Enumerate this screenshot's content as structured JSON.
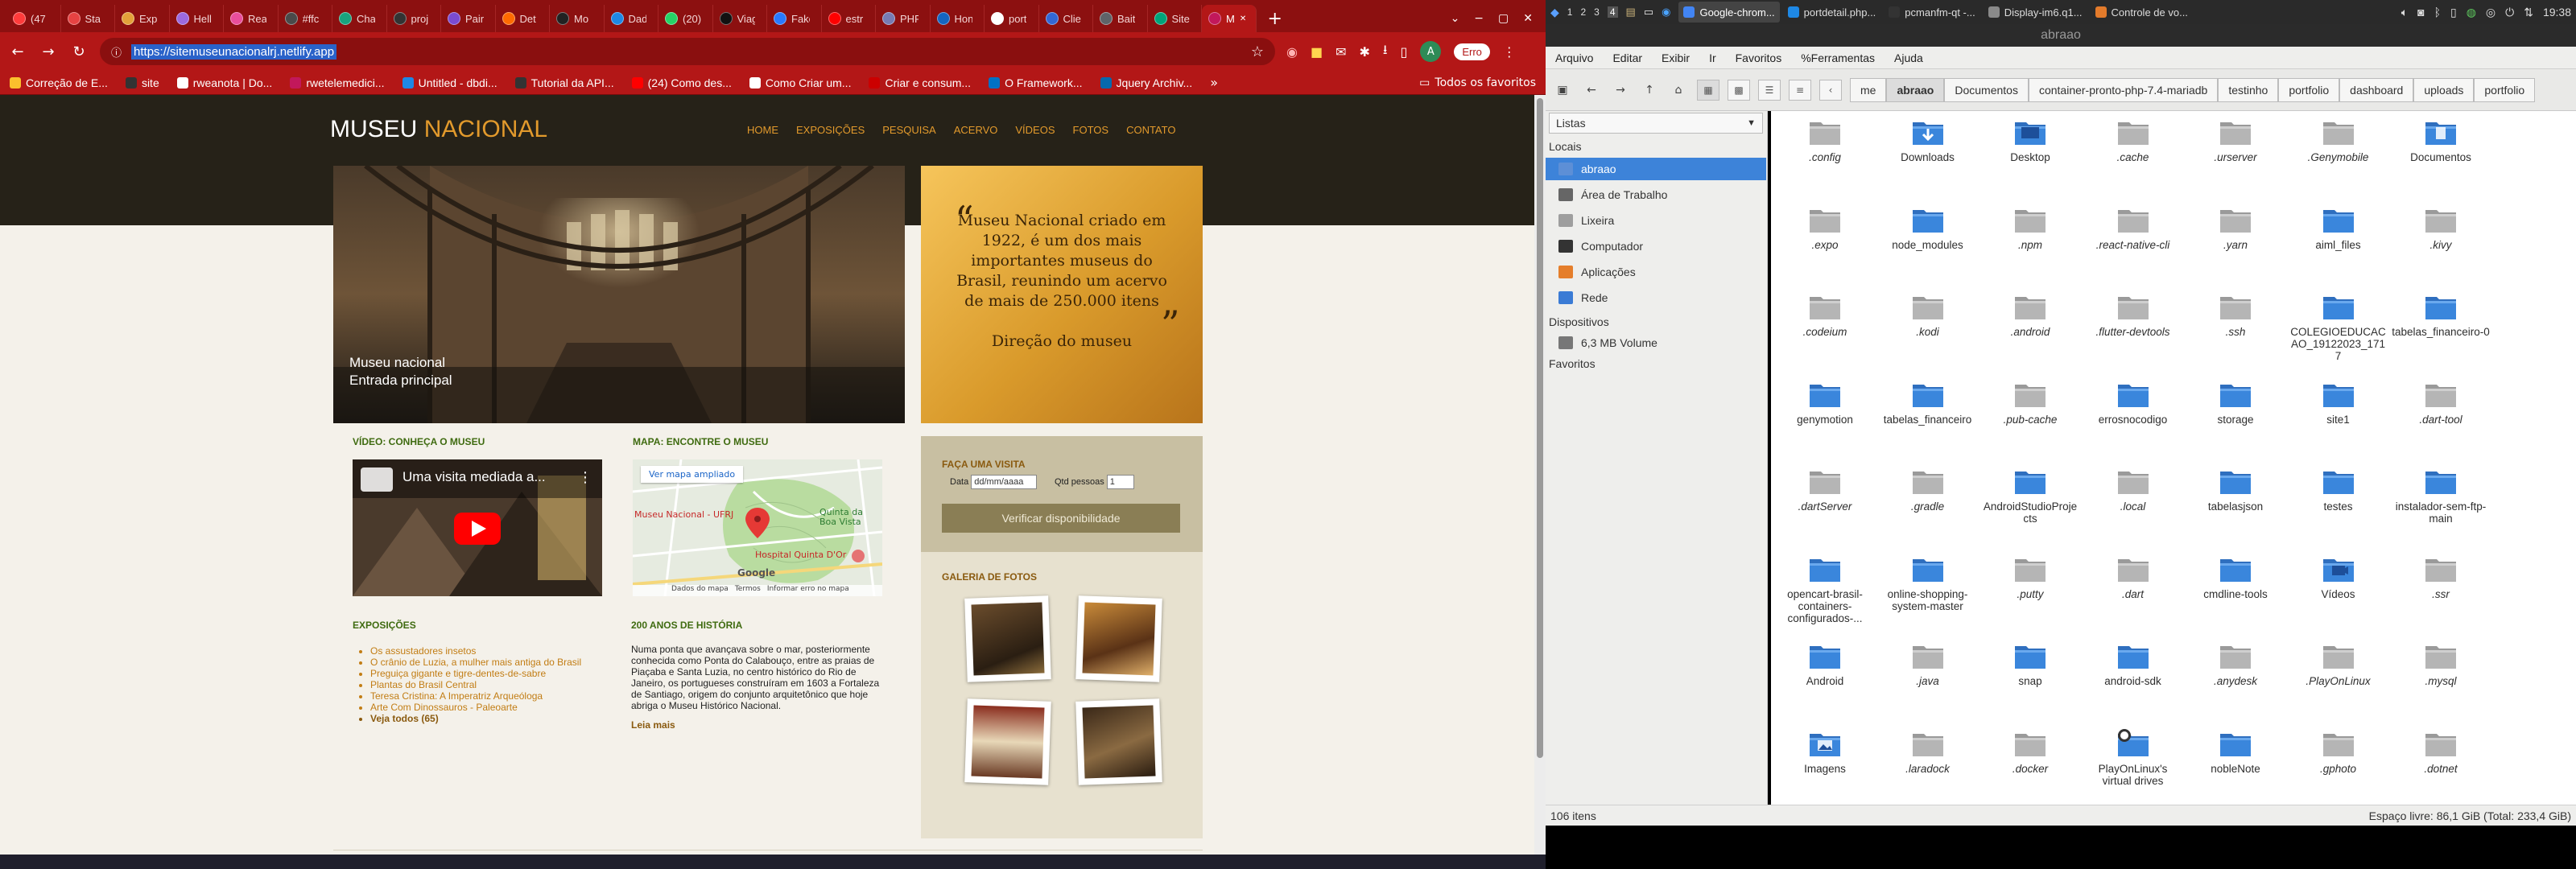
{
  "browser": {
    "tabs": [
      {
        "label": "(47",
        "color": "#ff3b3b"
      },
      {
        "label": "Sta",
        "color": "#e64242"
      },
      {
        "label": "Exp",
        "color": "#e3a13a"
      },
      {
        "label": "Hell",
        "color": "#9c6ade"
      },
      {
        "label": "Rea",
        "color": "#e94e9b"
      },
      {
        "label": "#ffc",
        "color": "#4a4a4a"
      },
      {
        "label": "Cha",
        "color": "#19a37e"
      },
      {
        "label": "proj",
        "color": "#333333"
      },
      {
        "label": "Pair",
        "color": "#7a4bd1"
      },
      {
        "label": "Det",
        "color": "#ff6a00"
      },
      {
        "label": "Mo",
        "color": "#222222"
      },
      {
        "label": "Dad",
        "color": "#1e88e5"
      },
      {
        "label": "(20)",
        "color": "#25d366"
      },
      {
        "label": "Viag",
        "color": "#111111"
      },
      {
        "label": "Fake",
        "color": "#2979ff"
      },
      {
        "label": "estr",
        "color": "#ff0000"
      },
      {
        "label": "PHP",
        "color": "#777bb3"
      },
      {
        "label": "Hon",
        "color": "#1565c0"
      },
      {
        "label": "port",
        "color": "#ffffff"
      },
      {
        "label": "Clie",
        "color": "#3367d6"
      },
      {
        "label": "Bait",
        "color": "#5f6368"
      },
      {
        "label": "Site",
        "color": "#00a37a"
      },
      {
        "label": "M",
        "color": "#c2185b"
      }
    ],
    "active_tab_index": 22,
    "url": "https://sitemuseunacionalrj.netlify.app",
    "error_pill": "Erro",
    "profile_initial": "A",
    "bookmarks": [
      {
        "label": "Correção de E...",
        "color": "#fbc02d"
      },
      {
        "label": "site",
        "color": "#333333"
      },
      {
        "label": "rweanota | Do...",
        "color": "#ffffff"
      },
      {
        "label": "rwetelemedici...",
        "color": "#c2185b"
      },
      {
        "label": "Untitled - dbdi...",
        "color": "#1e88e5"
      },
      {
        "label": "Tutorial da API...",
        "color": "#333333"
      },
      {
        "label": "(24) Como des...",
        "color": "#ff0000"
      },
      {
        "label": "Como Criar um...",
        "color": "#ffffff"
      },
      {
        "label": "Criar e consum...",
        "color": "#cc0000"
      },
      {
        "label": "O Framework...",
        "color": "#0071c5"
      },
      {
        "label": "Jquery Archiv...",
        "color": "#0769ad"
      }
    ],
    "all_bookmarks_label": "Todos os favoritos"
  },
  "site": {
    "logo_main": "MUSEU",
    "logo_accent": "NACIONAL",
    "nav": [
      "HOME",
      "EXPOSIÇÕES",
      "PESQUISA",
      "ACERVO",
      "VÍDEOS",
      "FOTOS",
      "CONTATO"
    ],
    "hero_caption_1": "Museu nacional",
    "hero_caption_2": "Entrada principal",
    "quote": "Museu Nacional criado em 1922, é um dos mais importantes museus do Brasil, reunindo um acervo de mais de 250.000 itens",
    "quote_author": "Direção do museu",
    "video_section_title": "VÍDEO: CONHEÇA O MUSEU",
    "video_title": "Uma visita mediada a...",
    "map_section_title": "MAPA: ENCONTRE O MUSEU",
    "map_link": "Ver mapa ampliado",
    "map_labels": {
      "museum": "Museu Nacional - UFRJ",
      "quinta": "Quinta da Boa Vista",
      "hospital": "Hospital Quinta D'Or",
      "brand": "Google",
      "footer": [
        "Dados do mapa",
        "Termos",
        "Informar erro no mapa"
      ]
    },
    "visit_title": "FAÇA UMA VISITA",
    "visit_date_label": "Data",
    "visit_date_placeholder": "dd/mm/aaaa",
    "visit_qty_label": "Qtd pessoas",
    "visit_qty_value": "1",
    "visit_button": "Verificar disponibilidade",
    "gallery_title": "GALERIA DE FOTOS",
    "expos_title": "EXPOSIÇÕES",
    "expos": [
      "Os assustadores insetos",
      "O crânio de Luzia, a mulher mais antiga do Brasil",
      "Preguiça gigante e tigre-dentes-de-sabre",
      "Plantas do Brasil Central",
      "Teresa Cristina: A Imperatriz Arqueóloga",
      "Arte Com Dinossauros - Paleoarte"
    ],
    "expos_more": "Veja todos (65)",
    "history_title": "200 ANOS DE HISTÓRIA",
    "history_text": "Numa ponta que avançava sobre o mar, posteriormente conhecida como Ponta do Calabouço, entre as praias de Piaçaba e Santa Luzia, no centro histórico do Rio de Janeiro, os portugueses construíram em 1603 a Fortaleza de Santiago, origem do conjunto arquitetônico que hoje abriga o Museu Histórico Nacional.",
    "history_more": "Leia mais"
  },
  "desktop": {
    "workspaces": [
      "1",
      "2",
      "3",
      "4"
    ],
    "tasks": [
      {
        "label": "Google-chrom...",
        "color": "#4285f4"
      },
      {
        "label": "portdetail.php...",
        "color": "#1e88e5"
      },
      {
        "label": "pcmanfm-qt -...",
        "color": "#333333"
      },
      {
        "label": "Display-im6.q1...",
        "color": "#8a8a8a"
      },
      {
        "label": "Controle de vo...",
        "color": "#e37b2b"
      }
    ],
    "clock": "19:38"
  },
  "files": {
    "window_title": "abraao",
    "menu": [
      "Arquivo",
      "Editar",
      "Exibir",
      "Ir",
      "Favoritos",
      "%Ferramentas",
      "Ajuda"
    ],
    "breadcrumbs": [
      "me",
      "abraao",
      "Documentos",
      "container-pronto-php-7.4-mariadb",
      "testinho",
      "portfolio",
      "dashboard",
      "uploads",
      "portfolio"
    ],
    "current_crumb_index": 1,
    "sidebar_mode": "Listas",
    "places_title": "Locais",
    "places": [
      {
        "label": "abraao",
        "color": "#5d8fd6"
      },
      {
        "label": "Área de Trabalho",
        "color": "#666666"
      },
      {
        "label": "Lixeira",
        "color": "#9e9e9e"
      },
      {
        "label": "Computador",
        "color": "#333333"
      },
      {
        "label": "Aplicações",
        "color": "#e57e2b"
      },
      {
        "label": "Rede",
        "color": "#3a7bd5"
      }
    ],
    "devices_title": "Dispositivos",
    "devices": [
      {
        "label": "6,3 MB Volume",
        "color": "#777777"
      }
    ],
    "bookmarks_title": "Favoritos",
    "items": [
      {
        "name": ".config",
        "type": "hidden"
      },
      {
        "name": "Downloads",
        "type": "downloads"
      },
      {
        "name": "Desktop",
        "type": "desktop"
      },
      {
        "name": ".cache",
        "type": "hidden"
      },
      {
        "name": ".urserver",
        "type": "hidden"
      },
      {
        "name": ".Genymobile",
        "type": "hidden"
      },
      {
        "name": "Documentos",
        "type": "docs"
      },
      {
        "name": ".expo",
        "type": "hidden"
      },
      {
        "name": "node_modules",
        "type": "folder"
      },
      {
        "name": ".npm",
        "type": "hidden"
      },
      {
        "name": ".react-native-cli",
        "type": "hidden"
      },
      {
        "name": ".yarn",
        "type": "hidden"
      },
      {
        "name": "aiml_files",
        "type": "folder"
      },
      {
        "name": ".kivy",
        "type": "hidden"
      },
      {
        "name": ".codeium",
        "type": "hidden"
      },
      {
        "name": ".kodi",
        "type": "hidden"
      },
      {
        "name": ".android",
        "type": "hidden"
      },
      {
        "name": ".flutter-devtools",
        "type": "hidden"
      },
      {
        "name": ".ssh",
        "type": "hidden"
      },
      {
        "name": "COLEGIOEDUCACAO_19122023_1717",
        "type": "folder"
      },
      {
        "name": "tabelas_financeiro-0",
        "type": "folder"
      },
      {
        "name": "genymotion",
        "type": "folder"
      },
      {
        "name": "tabelas_financeiro",
        "type": "folder"
      },
      {
        "name": ".pub-cache",
        "type": "hidden"
      },
      {
        "name": "errosnocodigo",
        "type": "folder"
      },
      {
        "name": "storage",
        "type": "folder"
      },
      {
        "name": "site1",
        "type": "folder"
      },
      {
        "name": ".dart-tool",
        "type": "hidden"
      },
      {
        "name": ".dartServer",
        "type": "hidden"
      },
      {
        "name": ".gradle",
        "type": "hidden"
      },
      {
        "name": "AndroidStudioProjects",
        "type": "folder"
      },
      {
        "name": ".local",
        "type": "hidden"
      },
      {
        "name": "tabelasjson",
        "type": "folder"
      },
      {
        "name": "testes",
        "type": "folder"
      },
      {
        "name": "instalador-sem-ftp-main",
        "type": "folder"
      },
      {
        "name": "opencart-brasil-containers-configurados-...",
        "type": "folder"
      },
      {
        "name": "online-shopping-system-master",
        "type": "folder"
      },
      {
        "name": ".putty",
        "type": "hidden"
      },
      {
        "name": ".dart",
        "type": "hidden"
      },
      {
        "name": "cmdline-tools",
        "type": "folder"
      },
      {
        "name": "Vídeos",
        "type": "videos"
      },
      {
        "name": ".ssr",
        "type": "hidden"
      },
      {
        "name": "Android",
        "type": "folder"
      },
      {
        "name": ".java",
        "type": "hidden"
      },
      {
        "name": "snap",
        "type": "folder"
      },
      {
        "name": "android-sdk",
        "type": "folder"
      },
      {
        "name": ".anydesk",
        "type": "hidden"
      },
      {
        "name": ".PlayOnLinux",
        "type": "hidden"
      },
      {
        "name": ".mysql",
        "type": "hidden"
      },
      {
        "name": "Imagens",
        "type": "images"
      },
      {
        "name": ".laradock",
        "type": "hidden"
      },
      {
        "name": ".docker",
        "type": "hidden"
      },
      {
        "name": "PlayOnLinux's virtual drives",
        "type": "link"
      },
      {
        "name": "nobleNote",
        "type": "folder"
      },
      {
        "name": ".gphoto",
        "type": "hidden"
      },
      {
        "name": ".dotnet",
        "type": "hidden"
      }
    ],
    "item_count": "106 itens",
    "free_space": "Espaço livre: 86,1 GiB (Total: 233,4 GiB)"
  }
}
